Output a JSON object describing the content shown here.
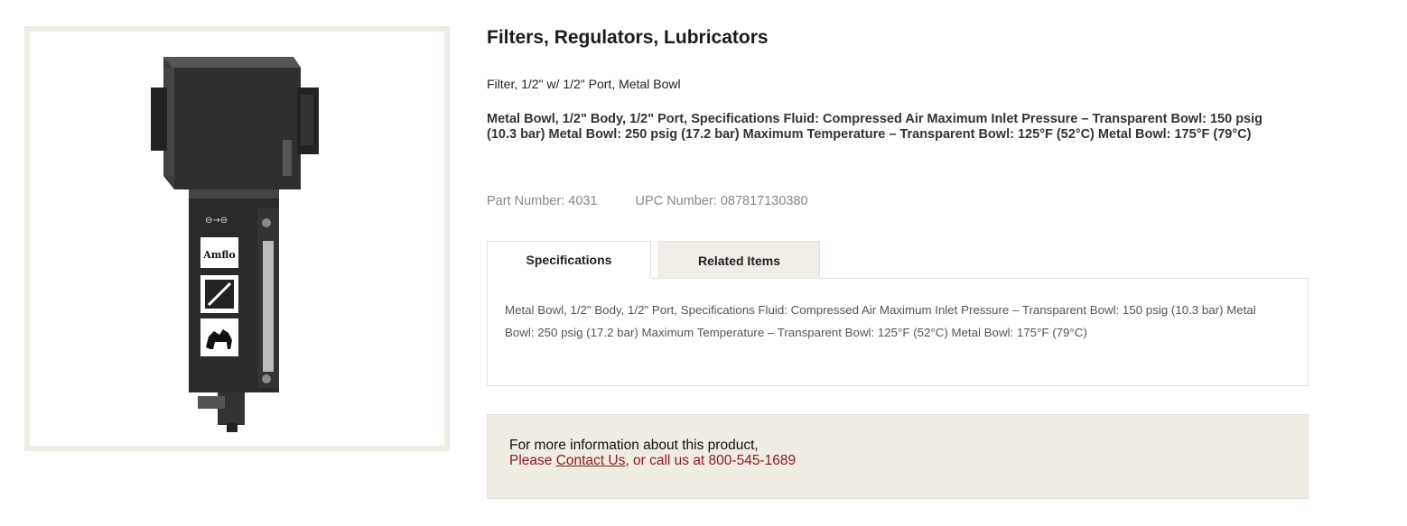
{
  "product": {
    "category_title": "Filters, Regulators, Lubricators",
    "short_description": "Filter, 1/2\" w/ 1/2\" Port, Metal Bowl",
    "long_description": "Metal Bowl, 1/2\" Body, 1/2\" Port, Specifications Fluid: Compressed Air Maximum Inlet Pressure – Transparent Bowl: 150 psig (10.3 bar) Metal Bowl: 250 psig (17.2 bar) Maximum Temperature – Transparent Bowl: 125°F (52°C) Metal Bowl: 175°F (79°C)",
    "part_number_label": "Part Number: 4031",
    "upc_number_label": "UPC Number: 087817130380",
    "image_brand": "Amflo"
  },
  "tabs": [
    {
      "label": "Specifications",
      "active": true
    },
    {
      "label": "Related Items",
      "active": false
    }
  ],
  "specifications_text": "Metal Bowl, 1/2\" Body, 1/2\" Port, Specifications Fluid: Compressed Air Maximum Inlet Pressure – Transparent Bowl: 150 psig (10.3 bar) Metal Bowl: 250 psig (17.2 bar) Maximum Temperature – Transparent Bowl: 125°F (52°C) Metal Bowl: 175°F (79°C)",
  "contact": {
    "line1": "For more information about this product,",
    "prefix": "Please ",
    "link_text": "Contact Us",
    "suffix": ", or call us at 800-545-1689"
  },
  "colors": {
    "frame_border": "#efece4",
    "contact_background": "#efece4",
    "contact_text": "#8b1a1a",
    "inactive_tab": "#f1eee7"
  }
}
